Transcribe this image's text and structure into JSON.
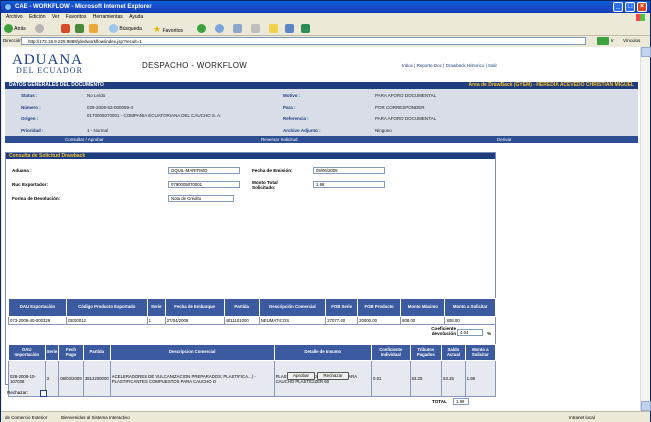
{
  "window": {
    "title": "CAE - WORKFLOW - Microsoft Internet Explorer",
    "menu": [
      "Archivo",
      "Edición",
      "Ver",
      "Favoritos",
      "Herramientas",
      "Ayuda"
    ],
    "toolbar": {
      "back": "Atrás",
      "search": "Búsqueda",
      "favorites": "Favoritos"
    },
    "address_label": "Dirección",
    "address": "http://172.18.9.225:8888/jdedworkflow/index.jsp?recult=1",
    "go_label": "Ir",
    "links_label": "Vínculos",
    "status_zone": "de Comercio Exterior",
    "status_msg": "Bienvenidos al Sistema Interactivo",
    "status_right": "Intranet local"
  },
  "header": {
    "logo_line1": "ADUANA",
    "logo_line2": "DEL ECUADOR",
    "app_title": "DESPACHO - WORKFLOW",
    "links": "Inbox | Reporte Doc | Drawback Historico | Salir"
  },
  "datos": {
    "title": "DATOS GENERALES DEL DOCUMENTO",
    "area": "Área de DrawBack (GYEM) - HEREDIA ACEVEDO CHRISTIAN MIGUEL",
    "status_label": "Status :",
    "status": "No Leído",
    "numero_label": "Número :",
    "numero": "028-2009-53-000059-4",
    "origen_label": "Origen :",
    "origen": "0170005070001 - COMPAÑIA ECUATORIANA DEL CAUCHO S. A.",
    "prioridad_label": "Prioridad :",
    "prioridad": "1 - Normal",
    "motivo_label": "Motivo :",
    "motivo": "PARA AFORO DOCUMENTAL",
    "para_label": "Para :",
    "para": "POR CORRESPONDER",
    "referencia_label": "Referencia :",
    "referencia": "PARA AFORO DOCUMENTAL",
    "adjunto_label": "Archivo Adjunto :",
    "adjunto": "Ninguno"
  },
  "actions": {
    "consultar": "Consultar / Aprobar",
    "reversar": "Reversar Solicitud",
    "derivar": "Derivar"
  },
  "consulta": {
    "title": "Consulta de Solicitud Drawback",
    "aduana_label": "Aduana :",
    "aduana": "GQUIL-MARITIMO",
    "fecha_label": "Fecha de Emisión:",
    "fecha": "09/06/2009",
    "ruc_label": "Ruc Exportador:",
    "ruc": "0790005070001",
    "monto_label": "Monto Total Solicitado:",
    "monto": "1.98",
    "forma_label": "Forma de Devolución:",
    "forma": "Nota de Crédito",
    "coef_label": "Coeficiente devolución",
    "coef": "4.04",
    "coef_unit": "%",
    "total_label": "TOTAL",
    "total": "1.98",
    "rechazar_label": "Rechazar:",
    "aprobar": "Aprobar",
    "rechazar": "Rechazar"
  },
  "export_table": {
    "headers": [
      "DAU Exportación",
      "Código Producto Exportado",
      "Serie",
      "Fecha de Embarque",
      "Partida",
      "Descripción Comercial",
      "FOB Serie",
      "FOB Producto",
      "Monto Máximo",
      "Monto a Solicitar"
    ],
    "rows": [
      [
        "073-2009-40-000329",
        "GE00012",
        "1",
        "27/04/2009",
        "4011101000",
        "NEUMATICOS",
        "27077.40",
        "20000.00",
        "808.00",
        "808.00"
      ]
    ]
  },
  "import_table": {
    "headers": [
      "DAU Importación",
      "Serie",
      "Fech Pago",
      "Partida",
      "Descripcion Comercial",
      "Detalle de Insumo",
      "Coeficiente Individual",
      "Tributos Pagados",
      "Saldo Actual",
      "Monto a Solicitar"
    ],
    "rows": [
      [
        "028-2008-10-107038",
        "3",
        "08/03/2009",
        "3812200000",
        "ACELERADORES DE VULCANIZACION PREPARADOS; PLASTIFICA...) - PLASTIFICANTES COMPUESTOS PARA CAUCHO O",
        "PLASTIFICANTES COMPUESTOS, PARA CAUCHO PLASTICIZER 60",
        "0.01",
        "63.25",
        "63.25",
        "1.98"
      ]
    ]
  },
  "colors": {
    "navy": "#1F3C7E",
    "gold": "#F4C430",
    "header_blue": "#3B5AA0"
  }
}
